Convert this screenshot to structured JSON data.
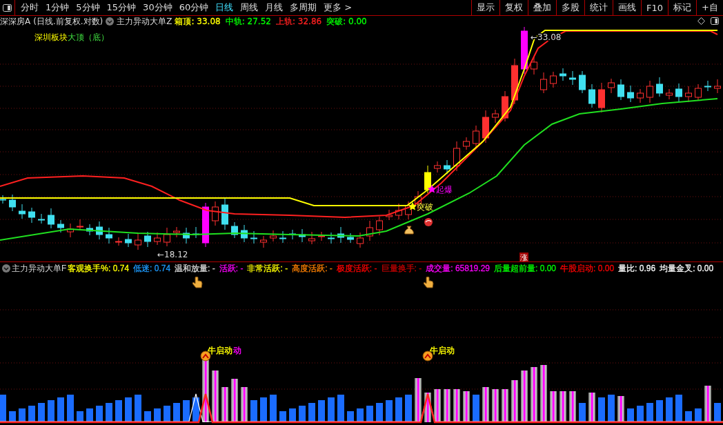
{
  "toolbar": {
    "tabs": [
      {
        "label": "分时",
        "selected": false
      },
      {
        "label": "1分钟",
        "selected": false
      },
      {
        "label": "5分钟",
        "selected": false
      },
      {
        "label": "15分钟",
        "selected": false
      },
      {
        "label": "30分钟",
        "selected": false
      },
      {
        "label": "60分钟",
        "selected": false
      },
      {
        "label": "日线",
        "selected": true
      },
      {
        "label": "周线",
        "selected": false
      },
      {
        "label": "月线",
        "selected": false
      },
      {
        "label": "多周期",
        "selected": false
      },
      {
        "label": "更多 >",
        "selected": false
      }
    ],
    "buttons": [
      "显示",
      "复权",
      "叠加",
      "多股",
      "统计",
      "画线",
      "F10",
      "标记",
      "+自"
    ]
  },
  "info_bar": {
    "stock": "深深房A",
    "mode": "(日线.前复权.对数)",
    "indicator": "主力异动大单Z",
    "values": [
      {
        "label": "箱顶:",
        "value": "33.08",
        "color": "#ffff00"
      },
      {
        "label": "中轨:",
        "value": "27.52",
        "color": "#00ff00"
      },
      {
        "label": "上轨:",
        "value": "32.86",
        "color": "#ff2020"
      },
      {
        "label": "突破:",
        "value": "0.00",
        "color": "#00ff00"
      }
    ]
  },
  "legend": {
    "board": "深圳板块",
    "pattern": "大顶（底）"
  },
  "chart_labels": {
    "high": "←33.08",
    "low": "←18.12",
    "breakout": "突破",
    "ignite": "起爆",
    "rise_badge": "涨"
  },
  "indicator_bar": {
    "name": "主力异动大单F",
    "values": [
      {
        "label": "客观换手%:",
        "value": "0.74",
        "color": "#ffff00"
      },
      {
        "label": "低迷:",
        "value": "0.74",
        "color": "#1e9bff"
      },
      {
        "label": "温和放量:",
        "value": "-",
        "color": "#dddddd"
      },
      {
        "label": "活跃:",
        "value": "-",
        "color": "#ff00ff"
      },
      {
        "label": "非常活跃:",
        "value": "-",
        "color": "#ffff00"
      },
      {
        "label": "高度活跃:",
        "value": "-",
        "color": "#ff8000"
      },
      {
        "label": "极度活跃:",
        "value": "-",
        "color": "#ff0000"
      },
      {
        "label": "巨量换手:",
        "value": "-",
        "color": "#c00000"
      },
      {
        "label": "成交量:",
        "value": "65819.29",
        "color": "#ff00ff"
      },
      {
        "label": "后量超前量:",
        "value": "0.00",
        "color": "#00ff00"
      },
      {
        "label": "牛股启动:",
        "value": "0.00",
        "color": "#ff0000"
      },
      {
        "label": "量比:",
        "value": "0.96",
        "color": "#ffffff"
      },
      {
        "label": "均量金叉:",
        "value": "0.00",
        "color": "#ffffff"
      }
    ]
  },
  "bull_start_labels": [
    {
      "text": "牛启动",
      "color": "#ffff00"
    },
    {
      "text": "动",
      "color": "#ff00ff"
    },
    {
      "text": "牛启动",
      "color": "#ffff00"
    }
  ]
}
